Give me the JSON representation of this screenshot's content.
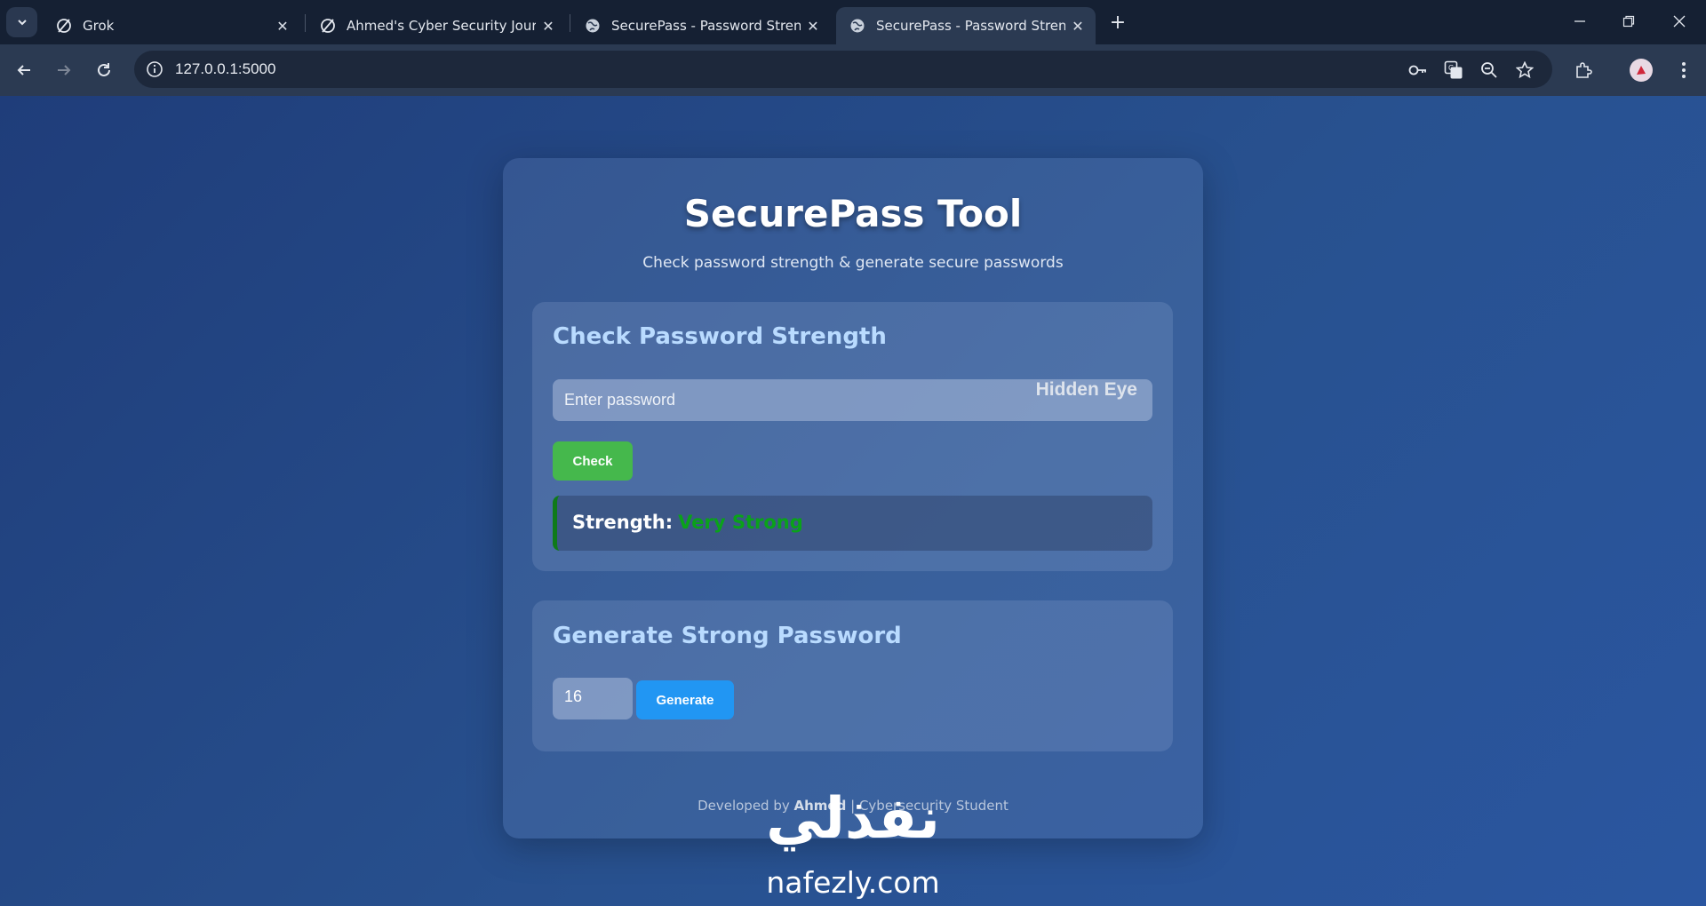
{
  "browser": {
    "tabs": [
      {
        "title": "Grok",
        "active": false
      },
      {
        "title": "Ahmed's Cyber Security Journey",
        "active": false
      },
      {
        "title": "SecurePass - Password Strength",
        "active": false
      },
      {
        "title": "SecurePass - Password Strength",
        "active": true
      }
    ],
    "url": "127.0.0.1:5000"
  },
  "app": {
    "title": "SecurePass Tool",
    "subtitle": "Check password strength & generate secure passwords"
  },
  "check_section": {
    "title": "Check Password Strength",
    "password_placeholder": "Enter password",
    "toggle_label": "Hidden Eye",
    "check_button": "Check",
    "strength_label": "Strength:",
    "strength_value": "Very Strong"
  },
  "generate_section": {
    "title": "Generate Strong Password",
    "length_value": "16",
    "generate_button": "Generate"
  },
  "footer": {
    "prefix": "Developed by",
    "author": "Ahmed",
    "suffix": "| Cybersecurity Student"
  },
  "watermark": {
    "arabic": "نفذلي",
    "domain": "nafezly.com"
  },
  "colors": {
    "check_button": "#45b84c",
    "generate_button": "#2196f3",
    "strength_value": "#0aa21a",
    "section_title": "#b9dbff"
  }
}
